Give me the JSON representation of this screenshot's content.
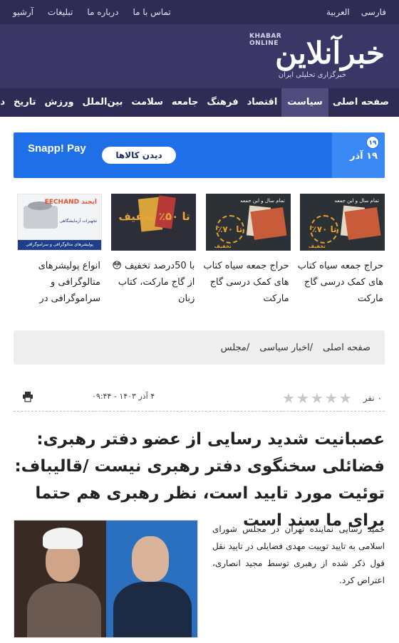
{
  "topbar": {
    "languages": [
      "فارسی",
      "العربية"
    ],
    "links": [
      "تماس با ما",
      "درباره ما",
      "تبلیغات",
      "آرشیو"
    ]
  },
  "logo": {
    "fa": "خبرآنلاین",
    "en": "KHABAR ONLINE",
    "tagline": "خبرگزاری تحلیلی ایران"
  },
  "nav": {
    "items": [
      "صفحه اصلی",
      "سیاست",
      "اقتصاد",
      "فرهنگ",
      "جامعه",
      "سلامت",
      "بین‌الملل",
      "ورزش",
      "تاریخ",
      "دانش"
    ],
    "active_index": 1
  },
  "banner": {
    "date_badge_number": "۱۹",
    "date_text": "۱۹ آذر",
    "cta": "دیدن کالاها",
    "brand": "Snapp! Pay"
  },
  "ads": [
    {
      "title": "حراج جمعه سیاه کتاب های کمک درسی گاج مارکت",
      "thumb_top": "تمام سال و این جمعه",
      "thumb_stamp": "تا ۷۰٪",
      "thumb_label": "تخفیف"
    },
    {
      "title": "حراج جمعه سیاه کتاب های کمک درسی گاج مارکت",
      "thumb_top": "تمام سال و این جمعه",
      "thumb_stamp": "تا ۷۰٪",
      "thumb_label": "تخفیف"
    },
    {
      "title": "با 50درصد تخفیف 😳 از گاج مارکت، کتاب زبان",
      "thumb_stamp": "تا ۵۰٪ تخفیف"
    },
    {
      "title": "انواع پولیشرهای متالوگرافی و سراموگرافی در",
      "thumb_brand": "ایجند EECHAND",
      "thumb_sub": "تجهیزات آزمایشگاهی",
      "thumb_bar": "پولیشرهای متالوگرافی و سراموگرافی"
    }
  ],
  "breadcrumb": [
    "صفحه اصلی",
    "/اخبار سیاسی",
    "/مجلس"
  ],
  "meta": {
    "votes": "۰ نفر",
    "date": "۴ آذر ۱۴۰۳ - ۰۹:۴۴"
  },
  "article": {
    "headline": "عصبانیت شدید رسایی از عضو دفتر رهبری: فضائلی سخنگوی دفتر رهبری نیست /قالیباف: توئیت مورد تایید است، نظر رهبری هم حتما برای ما سند است",
    "lead": "حمید رسایی نماینده تهران در مجلس شورای اسلامی به تایید توییت مهدی فضایلی در تایید نقل قول ذکر شده از رهبری توسط مجید انصاری، اعتراض کرد."
  }
}
